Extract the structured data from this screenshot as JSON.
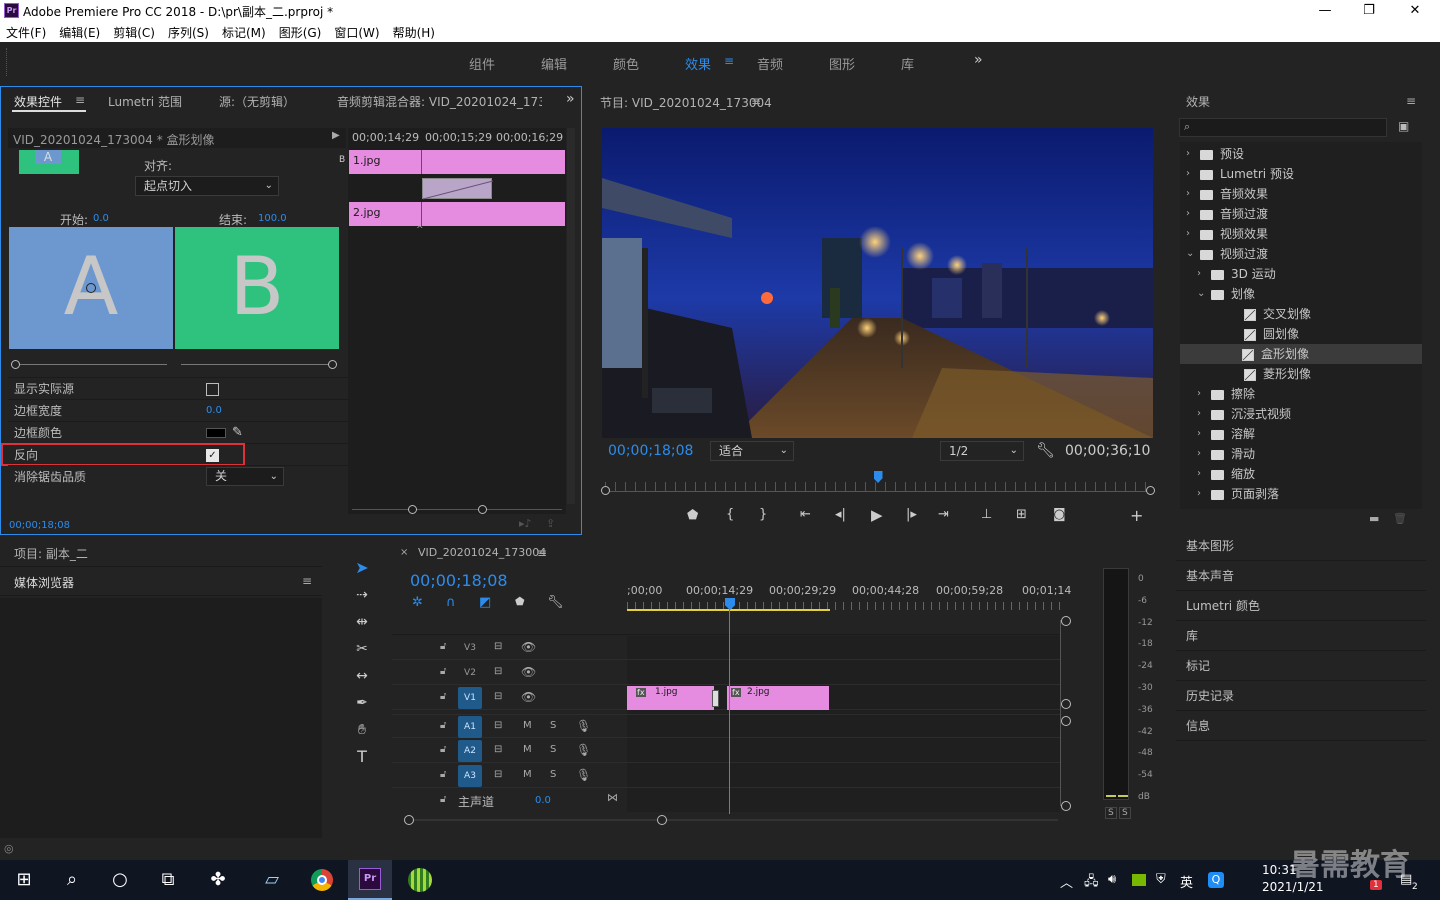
{
  "window": {
    "title": "Adobe Premiere Pro CC 2018 - D:\\pr\\副本_二.prproj *",
    "app_icon": "Pr"
  },
  "menu": [
    "文件(F)",
    "编辑(E)",
    "剪辑(C)",
    "序列(S)",
    "标记(M)",
    "图形(G)",
    "窗口(W)",
    "帮助(H)"
  ],
  "workspaces": [
    "组件",
    "编辑",
    "颜色",
    "效果",
    "音频",
    "图形",
    "库"
  ],
  "workspace_active": "效果",
  "more_glyph": "»",
  "effect_controls": {
    "tabs": [
      "效果控件",
      "Lumetri 范围",
      "源:（无剪辑）",
      "音频剪辑混合器: VID_20201024_17300"
    ],
    "clip_path": "VID_20201024_173004 * 盒形划像",
    "align_label": "对齐:",
    "align_value": "起点切入",
    "start_label": "开始:",
    "start_value": "0.0",
    "end_label": "结束:",
    "end_value": "100.0",
    "preview_a": "A",
    "preview_b": "B",
    "props": [
      {
        "label": "显示实际源",
        "type": "checkbox",
        "checked": false
      },
      {
        "label": "边框宽度",
        "type": "value",
        "value": "0.0"
      },
      {
        "label": "边框颜色",
        "type": "color"
      },
      {
        "label": "反向",
        "type": "checkbox",
        "checked": true
      },
      {
        "label": "消除锯齿品质",
        "type": "select",
        "value": "关"
      }
    ],
    "timecodes": [
      "00;00;14;29",
      "00;00;15;29",
      "00;00;16;29"
    ],
    "track_letter": "B",
    "clip1": "1.jpg",
    "clip2": "2.jpg",
    "current_time": "00;00;18;08"
  },
  "program": {
    "title": "节目: VID_20201024_173004",
    "timecode": "00;00;18;08",
    "fit": "适合",
    "resolution": "1/2",
    "duration": "00;00;36;10",
    "playhead_fraction": 0.5
  },
  "effects_panel": {
    "title": "效果",
    "tree": [
      {
        "label": "预设",
        "level": 0,
        "kind": "folder-star",
        "open": false
      },
      {
        "label": "Lumetri 预设",
        "level": 0,
        "kind": "folder-star",
        "open": false
      },
      {
        "label": "音频效果",
        "level": 0,
        "kind": "folder",
        "open": false
      },
      {
        "label": "音频过渡",
        "level": 0,
        "kind": "folder",
        "open": false
      },
      {
        "label": "视频效果",
        "level": 0,
        "kind": "folder",
        "open": false
      },
      {
        "label": "视频过渡",
        "level": 0,
        "kind": "folder",
        "open": true
      },
      {
        "label": "3D 运动",
        "level": 1,
        "kind": "folder",
        "open": false
      },
      {
        "label": "划像",
        "level": 1,
        "kind": "folder",
        "open": true
      },
      {
        "label": "交叉划像",
        "level": 2,
        "kind": "fx"
      },
      {
        "label": "圆划像",
        "level": 2,
        "kind": "fx"
      },
      {
        "label": "盒形划像",
        "level": 2,
        "kind": "fx",
        "selected": true
      },
      {
        "label": "菱形划像",
        "level": 2,
        "kind": "fx"
      },
      {
        "label": "擦除",
        "level": 1,
        "kind": "folder",
        "open": false
      },
      {
        "label": "沉浸式视频",
        "level": 1,
        "kind": "folder",
        "open": false
      },
      {
        "label": "溶解",
        "level": 1,
        "kind": "folder",
        "open": false
      },
      {
        "label": "滑动",
        "level": 1,
        "kind": "folder",
        "open": false
      },
      {
        "label": "缩放",
        "level": 1,
        "kind": "folder",
        "open": false
      },
      {
        "label": "页面剥落",
        "level": 1,
        "kind": "folder",
        "open": false
      }
    ]
  },
  "right_panels": [
    "基本图形",
    "基本声音",
    "Lumetri 颜色",
    "库",
    "标记",
    "历史记录",
    "信息"
  ],
  "project": {
    "title": "项目: 副本_二",
    "media_browser": "媒体浏览器"
  },
  "timeline": {
    "tab": "VID_20201024_173004",
    "timecode": "00;00;18;08",
    "ruler": [
      ";00;00",
      "00;00;14;29",
      "00;00;29;29",
      "00;00;44;28",
      "00;00;59;28",
      "00;01;14"
    ],
    "video_tracks": [
      "V3",
      "V2",
      "V1"
    ],
    "audio_tracks": [
      "A1",
      "A2",
      "A3"
    ],
    "clip1": "1.jpg",
    "clip2": "2.jpg",
    "fx_badge": "fx",
    "master_label": "主声道",
    "master_value": "0.0",
    "m_label": "M",
    "s_label": "S"
  },
  "meter": {
    "labels": [
      "0",
      "-6",
      "-12",
      "-18",
      "-24",
      "-30",
      "-36",
      "-42",
      "-48",
      "-54",
      "dB"
    ],
    "solo": [
      "S",
      "S"
    ]
  },
  "taskbar": {
    "time": "10:31",
    "date": "2021/1/21",
    "lang": "英",
    "watermark": "暑需教育",
    "badge1": "1",
    "badge2": "2"
  },
  "colors": {
    "accent_blue": "#2d8ceb",
    "clip_pink": "#e58be0",
    "preview_a": "#6d98cf",
    "preview_b": "#2fc27e",
    "highlight_red": "#e0313a"
  }
}
